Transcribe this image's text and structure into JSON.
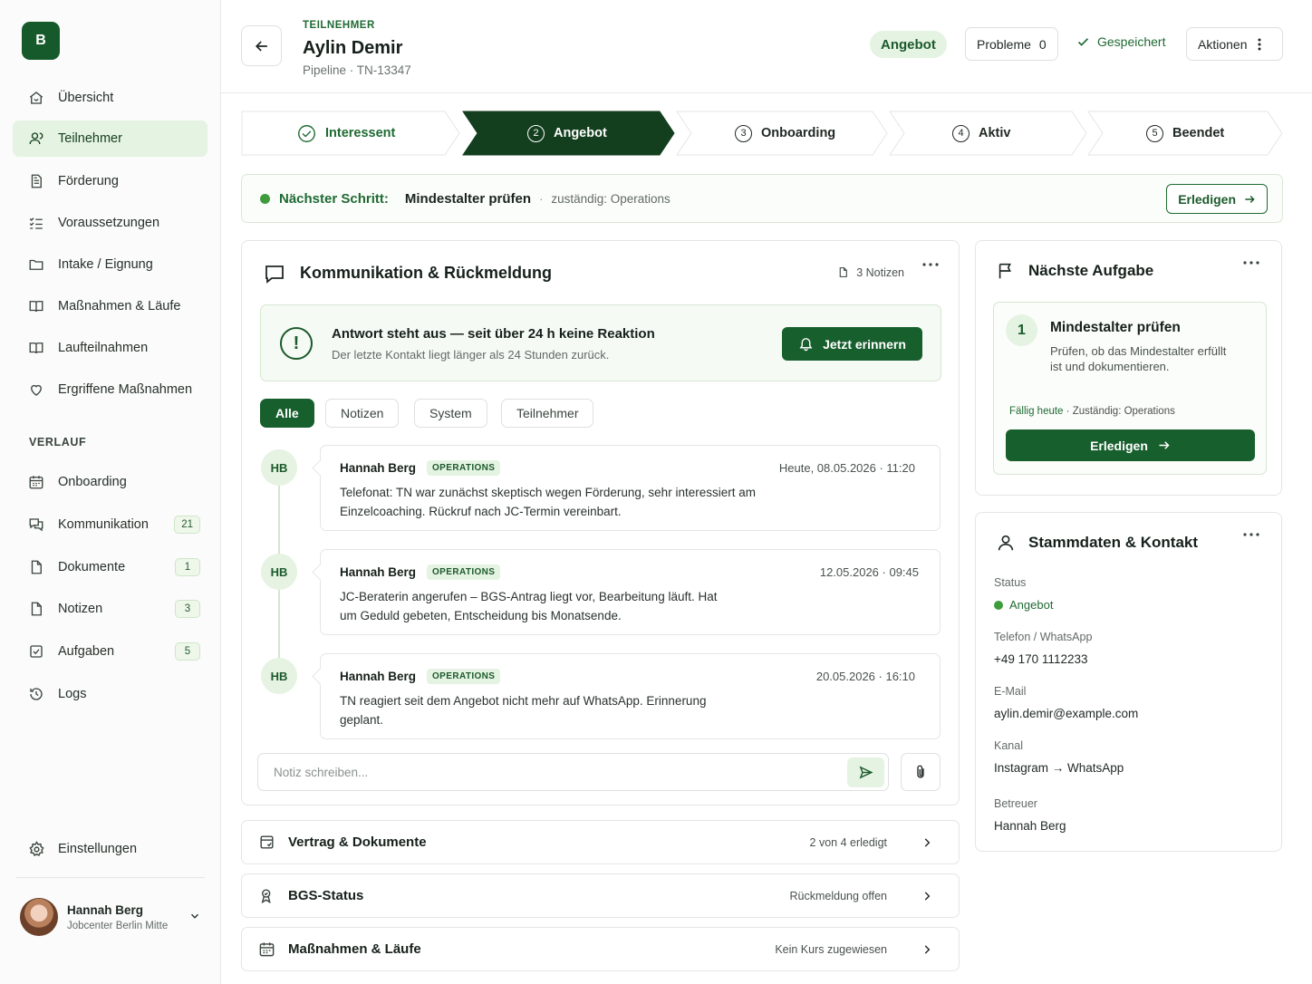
{
  "app": {
    "logo_letter": "B"
  },
  "sidebar": {
    "main_items": [
      {
        "label": "Übersicht",
        "icon": "home-icon"
      },
      {
        "label": "Teilnehmer",
        "icon": "users-icon",
        "active": true
      },
      {
        "label": "Förderung",
        "icon": "document-icon"
      },
      {
        "label": "Voraussetzungen",
        "icon": "checklist-icon"
      },
      {
        "label": "Intake / Eignung",
        "icon": "folder-icon"
      },
      {
        "label": "Maßnahmen & Läufe",
        "icon": "book-icon"
      },
      {
        "label": "Laufteilnahmen",
        "icon": "book-open-icon"
      },
      {
        "label": "Ergriffene Maßnahmen",
        "icon": "heart-icon"
      }
    ],
    "section_label": "VERLAUF",
    "history_items": [
      {
        "label": "Onboarding",
        "icon": "calendar-icon",
        "badge": ""
      },
      {
        "label": "Kommunikation",
        "icon": "chat-icon",
        "badge": "21"
      },
      {
        "label": "Dokumente",
        "icon": "file-icon",
        "badge": "1"
      },
      {
        "label": "Notizen",
        "icon": "note-icon",
        "badge": "3"
      },
      {
        "label": "Aufgaben",
        "icon": "checkbox-icon",
        "badge": "5"
      },
      {
        "label": "Logs",
        "icon": "history-icon",
        "badge": ""
      }
    ],
    "settings_label": "Einstellungen",
    "user": {
      "name": "Hannah Berg",
      "org": "Jobcenter Berlin Mitte"
    }
  },
  "header": {
    "eyebrow": "TEILNEHMER",
    "title": "Aylin Demir",
    "subtitle": "Pipeline · TN-13347",
    "stage": "Angebot",
    "problems_label": "Probleme",
    "problems_count": "0",
    "saved_label": "Gespeichert",
    "actions_label": "Aktionen"
  },
  "stepper": {
    "steps": [
      {
        "num": "1",
        "label": "Interessent",
        "state": "done"
      },
      {
        "num": "2",
        "label": "Angebot",
        "state": "active"
      },
      {
        "num": "3",
        "label": "Onboarding",
        "state": "todo"
      },
      {
        "num": "4",
        "label": "Aktiv",
        "state": "todo"
      },
      {
        "num": "5",
        "label": "Beendet",
        "state": "todo"
      }
    ]
  },
  "next_step": {
    "label": "Nächster Schritt:",
    "task": "Mindestalter prüfen",
    "separator": "·",
    "owner": "zuständig: Operations",
    "button": "Erledigen"
  },
  "communication": {
    "title": "Kommunikation & Rückmeldung",
    "notes_count": "3 Notizen",
    "alert": {
      "title": "Antwort steht aus — seit über 24 h keine Reaktion",
      "subtitle": "Der letzte Kontakt liegt länger als 24 Stunden zurück.",
      "button": "Jetzt erinnern"
    },
    "filters": [
      "Alle",
      "Notizen",
      "System",
      "Teilnehmer"
    ],
    "messages": [
      {
        "initials": "HB",
        "author": "Hannah Berg",
        "tag": "OPERATIONS",
        "time": "Heute, 08.05.2026 · 11:20",
        "text": "Telefonat: TN war zunächst skeptisch wegen Förderung, sehr interessiert am Einzelcoaching. Rückruf nach JC-Termin vereinbart."
      },
      {
        "initials": "HB",
        "author": "Hannah Berg",
        "tag": "OPERATIONS",
        "time": "12.05.2026 · 09:45",
        "text": "JC-Beraterin angerufen – BGS-Antrag liegt vor, Bearbeitung läuft. Hat um Geduld gebeten, Entscheidung bis Monatsende."
      },
      {
        "initials": "HB",
        "author": "Hannah Berg",
        "tag": "OPERATIONS",
        "time": "20.05.2026 · 16:10",
        "text": "TN reagiert seit dem Angebot nicht mehr auf WhatsApp. Erinnerung geplant."
      }
    ],
    "composer_placeholder": "Notiz schreiben..."
  },
  "sections": [
    {
      "title": "Vertrag & Dokumente",
      "meta": "2 von 4 erledigt",
      "icon": "contract-icon"
    },
    {
      "title": "BGS-Status",
      "meta": "Rückmeldung offen",
      "icon": "badge-icon"
    },
    {
      "title": "Maßnahmen & Läufe",
      "meta": "Kein Kurs zugewiesen",
      "icon": "calendar-icon"
    }
  ],
  "next_task": {
    "title": "Nächste Aufgabe",
    "number": "1",
    "task_title": "Mindestalter prüfen",
    "description": "Prüfen, ob das Mindestalter erfüllt ist und dokumentieren.",
    "due": "Fällig heute",
    "owner": " · Zuständig: Operations",
    "button": "Erledigen"
  },
  "master_data": {
    "title": "Stammdaten & Kontakt",
    "status_label": "Status",
    "status_value": "Angebot",
    "phone_label": "Telefon / WhatsApp",
    "phone_value": "+49 170 1112233",
    "email_label": "E-Mail",
    "email_value": "aylin.demir@example.com",
    "channel_label": "Kanal",
    "channel_value": "Instagram → WhatsApp",
    "advisor_label": "Betreuer",
    "advisor_value": "Hannah Berg"
  },
  "colors": {
    "brand": "#165a2b",
    "accent_green": "#185f2e",
    "light_green": "#e5f3e2",
    "status_dot": "#3e9c3c"
  }
}
